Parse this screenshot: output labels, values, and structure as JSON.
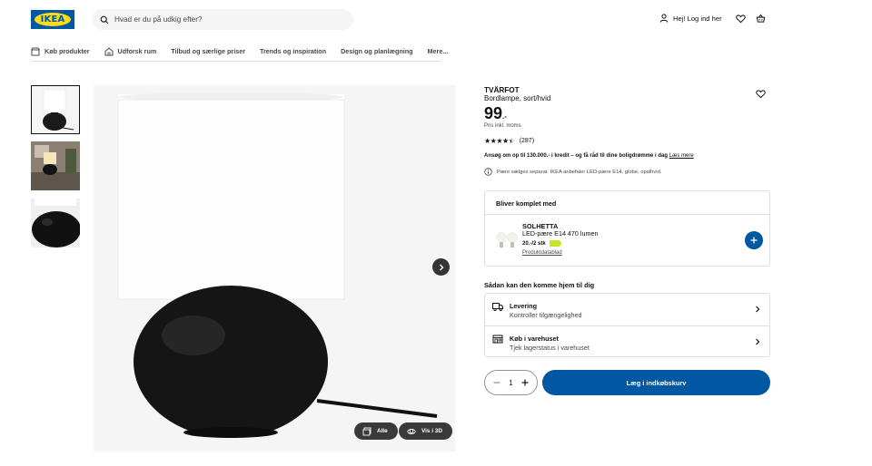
{
  "header": {
    "logo_text": "IKEA",
    "search_placeholder": "Hvad er du på udkig efter?",
    "login_label": "Hej! Log ind her",
    "icons": [
      "search-icon",
      "user-icon",
      "heart-icon",
      "cart-icon"
    ]
  },
  "nav": [
    {
      "label": "Køb produkter",
      "icon": "store-icon"
    },
    {
      "label": "Udforsk rum",
      "icon": "home-icon"
    },
    {
      "label": "Tilbud og særlige priser"
    },
    {
      "label": "Trends og inspiration"
    },
    {
      "label": "Design og planlægning"
    },
    {
      "label": "Mere..."
    }
  ],
  "gallery": {
    "buttons": {
      "all_label": "Alle",
      "view3d_label": "Vis i 3D"
    }
  },
  "product": {
    "name": "TVÄRFOT",
    "description": "Bordlampe, sort/hvid",
    "price_main": "99",
    "price_suffix": ".-",
    "price_note": "Pris inkl. moms",
    "rating_stars": 4.5,
    "review_count": "(287)"
  },
  "promo": {
    "text": "Ansøg om op til 130.000.- i kredit – og få råd til dine boligdrømme i dag",
    "link": "Læs mere"
  },
  "info_note": "Pære sælges separat. IKEA anbefaler LED-pære E14, globe, opalhvid.",
  "accessory": {
    "section_title": "Bliver komplet med",
    "name": "SOLHETTA",
    "description": "LED-pære E14 470 lumen",
    "price": "20.-/2 stk",
    "link": "Produktdatablad",
    "energy_class_color": "#c9e32d"
  },
  "delivery": {
    "title": "Sådan kan den komme hjem til dig",
    "options": [
      {
        "title": "Levering",
        "subtitle": "Kontroller tilgængelighed",
        "icon": "truck-icon"
      },
      {
        "title": "Køb i varehuset",
        "subtitle": "Tjek lagerstatus i varehuset",
        "icon": "store-icon"
      }
    ]
  },
  "purchase": {
    "quantity": "1",
    "add_to_cart_label": "Læg i indkøbskurv"
  },
  "colors": {
    "brand_blue": "#0058a3",
    "brand_yellow": "#ffda1a"
  }
}
